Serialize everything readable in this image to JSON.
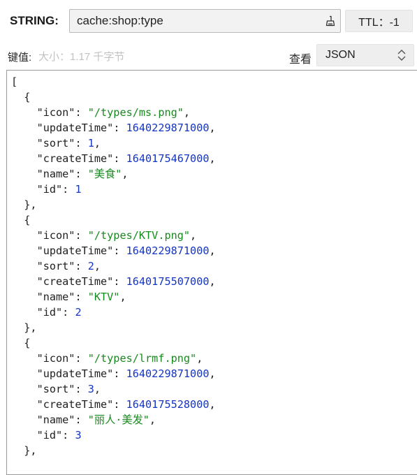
{
  "header": {
    "type_label": "STRING:",
    "key_value": "cache:shop:type",
    "ttl_label": "TTL：-1"
  },
  "value_bar": {
    "value_label": "键值:",
    "size_label": "大小：1.17 千字节",
    "view_label": "查看",
    "format_selected": "JSON"
  },
  "json_items": [
    {
      "icon": "/types/ms.png",
      "updateTime": "1640229871000",
      "sort": "1",
      "createTime": "1640175467000",
      "name": "美食",
      "id": "1"
    },
    {
      "icon": "/types/KTV.png",
      "updateTime": "1640229871000",
      "sort": "2",
      "createTime": "1640175507000",
      "name": "KTV",
      "id": "2"
    },
    {
      "icon": "/types/lrmf.png",
      "updateTime": "1640229871000",
      "sort": "3",
      "createTime": "1640175528000",
      "name": "丽人·美发",
      "id": "3"
    }
  ],
  "colors": {
    "string_token": "#178a1e",
    "number_token": "#1534c4",
    "key_token": "#1f1f1f"
  },
  "icons": {
    "clear": "broom-icon",
    "format_arrows": "chevron-up-down-icon"
  }
}
